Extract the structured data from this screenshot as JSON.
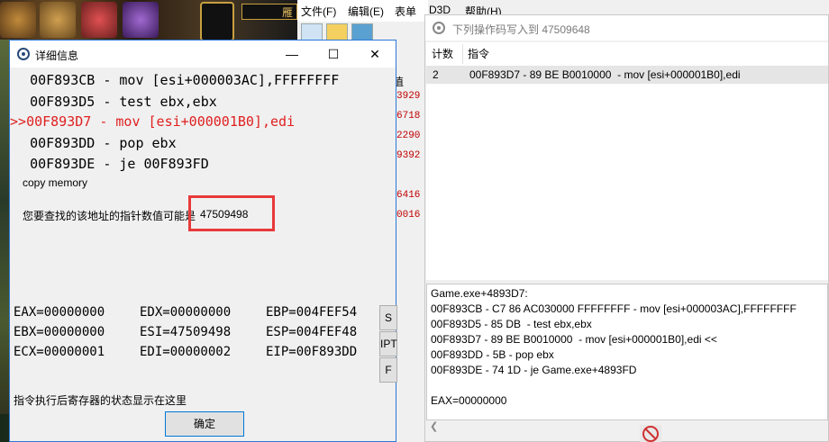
{
  "background_game": {
    "top_label": "雁"
  },
  "ce_menu": {
    "items": [
      "文件(F)",
      "编辑(E)",
      "表单",
      "D3D",
      "帮助(H)"
    ]
  },
  "ce_background_values": [
    "3929",
    "6718",
    "2290",
    "9392",
    "",
    "6416",
    "0016"
  ],
  "detail_window": {
    "title": "详细信息",
    "asm_lines": [
      {
        "prefix": "  ",
        "text": "00F893CB - mov [esi+000003AC],FFFFFFFF"
      },
      {
        "prefix": "  ",
        "text": "00F893D5 - test ebx,ebx"
      },
      {
        "prefix": ">>",
        "text": "00F893D7 - mov [esi+000001B0],edi"
      },
      {
        "prefix": "  ",
        "text": "00F893DD - pop ebx"
      },
      {
        "prefix": "  ",
        "text": "00F893DE - je 00F893FD"
      }
    ],
    "copy_memory": "copy memory",
    "pointer_hint": "您要查找的该地址的指针数值可能是",
    "pointer_value": "47509498",
    "registers": [
      [
        "EAX=00000000",
        "EDX=00000000",
        "EBP=004FEF54"
      ],
      [
        "EBX=00000000",
        "ESI=47509498",
        "ESP=004FEF48"
      ],
      [
        "ECX=00000001",
        "EDI=00000002",
        "EIP=00F893DD"
      ]
    ],
    "side_buttons": [
      "S",
      "IPT",
      "F"
    ],
    "footer_note": "指令执行后寄存器的状态显示在这里",
    "ok_label": "确定"
  },
  "opcode_window": {
    "title": "下列操作码写入到 47509648",
    "columns": [
      "计数",
      "指令"
    ],
    "rows": [
      {
        "count": "2",
        "instruction": "00F893D7 - 89 BE B0010000  - mov [esi+000001B0],edi"
      }
    ],
    "info_lines": [
      "Game.exe+4893D7:",
      "00F893CB - C7 86 AC030000 FFFFFFFF - mov [esi+000003AC],FFFFFFFF",
      "00F893D5 - 85 DB  - test ebx,ebx",
      "00F893D7 - 89 BE B0010000  - mov [esi+000001B0],edi <<",
      "00F893DD - 5B - pop ebx",
      "00F893DE - 74 1D - je Game.exe+4893FD",
      "",
      "EAX=00000000"
    ]
  },
  "colors": {
    "highlight_red": "#e02020",
    "annotation_box": "#e8393a",
    "selected_row": "#e5e5e5"
  }
}
